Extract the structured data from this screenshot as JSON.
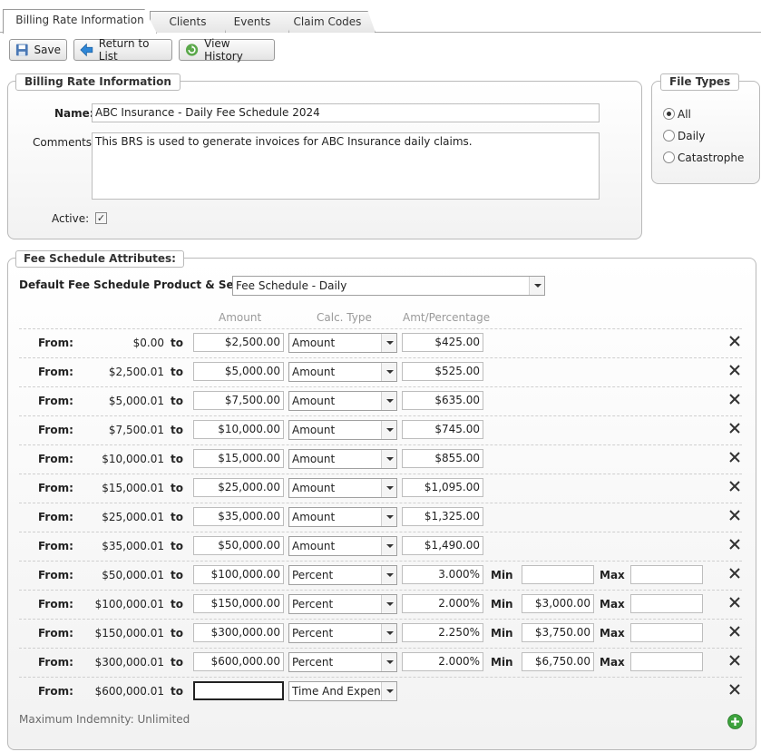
{
  "tabs": [
    "Billing Rate Information",
    "Clients",
    "Events",
    "Claim Codes"
  ],
  "toolbar": {
    "save": "Save",
    "return": "Return to List",
    "history": "View History"
  },
  "billing": {
    "legend": "Billing Rate Information",
    "name_label": "Name:",
    "name_value": "ABC Insurance - Daily Fee Schedule 2024",
    "comments_label": "Comments:",
    "comments_value": "This BRS is used to generate invoices for ABC Insurance daily claims.",
    "active_label": "Active:",
    "active_checked": true
  },
  "file_types": {
    "legend": "File Types",
    "options": [
      "All",
      "Daily",
      "Catastrophe"
    ],
    "selected": "All"
  },
  "fee": {
    "legend": "Fee Schedule Attributes:",
    "default_label": "Default Fee Schedule Product & Service:",
    "default_value": "Fee Schedule - Daily",
    "col_amount": "Amount",
    "col_calc": "Calc. Type",
    "col_amt_pct": "Amt/Percentage",
    "from_label": "From:",
    "to_label": "to",
    "min_label": "Min",
    "max_label": "Max",
    "rows": [
      {
        "from": "$0.00",
        "to": "$2,500.00",
        "calc": "Amount",
        "amt": "$425.00"
      },
      {
        "from": "$2,500.01",
        "to": "$5,000.00",
        "calc": "Amount",
        "amt": "$525.00"
      },
      {
        "from": "$5,000.01",
        "to": "$7,500.00",
        "calc": "Amount",
        "amt": "$635.00"
      },
      {
        "from": "$7,500.01",
        "to": "$10,000.00",
        "calc": "Amount",
        "amt": "$745.00"
      },
      {
        "from": "$10,000.01",
        "to": "$15,000.00",
        "calc": "Amount",
        "amt": "$855.00"
      },
      {
        "from": "$15,000.01",
        "to": "$25,000.00",
        "calc": "Amount",
        "amt": "$1,095.00"
      },
      {
        "from": "$25,000.01",
        "to": "$35,000.00",
        "calc": "Amount",
        "amt": "$1,325.00"
      },
      {
        "from": "$35,000.01",
        "to": "$50,000.00",
        "calc": "Amount",
        "amt": "$1,490.00"
      },
      {
        "from": "$50,000.01",
        "to": "$100,000.00",
        "calc": "Percent",
        "amt": "3.000%",
        "min": "",
        "max": ""
      },
      {
        "from": "$100,000.01",
        "to": "$150,000.00",
        "calc": "Percent",
        "amt": "2.000%",
        "min": "$3,000.00",
        "max": ""
      },
      {
        "from": "$150,000.01",
        "to": "$300,000.00",
        "calc": "Percent",
        "amt": "2.250%",
        "min": "$3,750.00",
        "max": ""
      },
      {
        "from": "$300,000.01",
        "to": "$600,000.00",
        "calc": "Percent",
        "amt": "2.000%",
        "min": "$6,750.00",
        "max": ""
      },
      {
        "from": "$600,000.01",
        "to": "",
        "calc": "Time And Expense"
      }
    ],
    "max_indemnity": "Maximum Indemnity: Unlimited"
  }
}
